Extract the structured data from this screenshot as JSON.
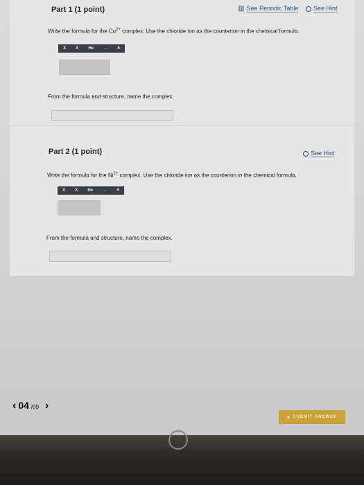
{
  "part1": {
    "title": "Part 1",
    "points": "(1 point)",
    "periodic_table": "See Periodic Table",
    "hint": "See Hint",
    "question_prefix": "Write the formula for the Cu",
    "question_charge": "2+",
    "question_suffix": " complex. Use the chloride ion as the counterion in the chemical formula.",
    "subquestion": "From the formula and structure, name the complex."
  },
  "part2": {
    "title": "Part 2",
    "points": "(1 point)",
    "hint": "See Hint",
    "question_prefix": "Write the formula for the Ni",
    "question_charge": "2+",
    "question_suffix": " complex. Use the chloride ion as the counterion in the chemical formula.",
    "subquestion": "From the formula and structure, name the complex."
  },
  "toolbar": {
    "subscript": "X",
    "superscript": "X",
    "state": "He",
    "arrow": "→",
    "delta": "δ"
  },
  "footer": {
    "prev": "‹",
    "page": "04",
    "total": "/09",
    "next": "›",
    "submit": "SUBMIT ANSWER"
  },
  "colors": {
    "accent": "#c9a33a",
    "link": "#2b4f7a",
    "toolbar": "#3a3f47"
  }
}
